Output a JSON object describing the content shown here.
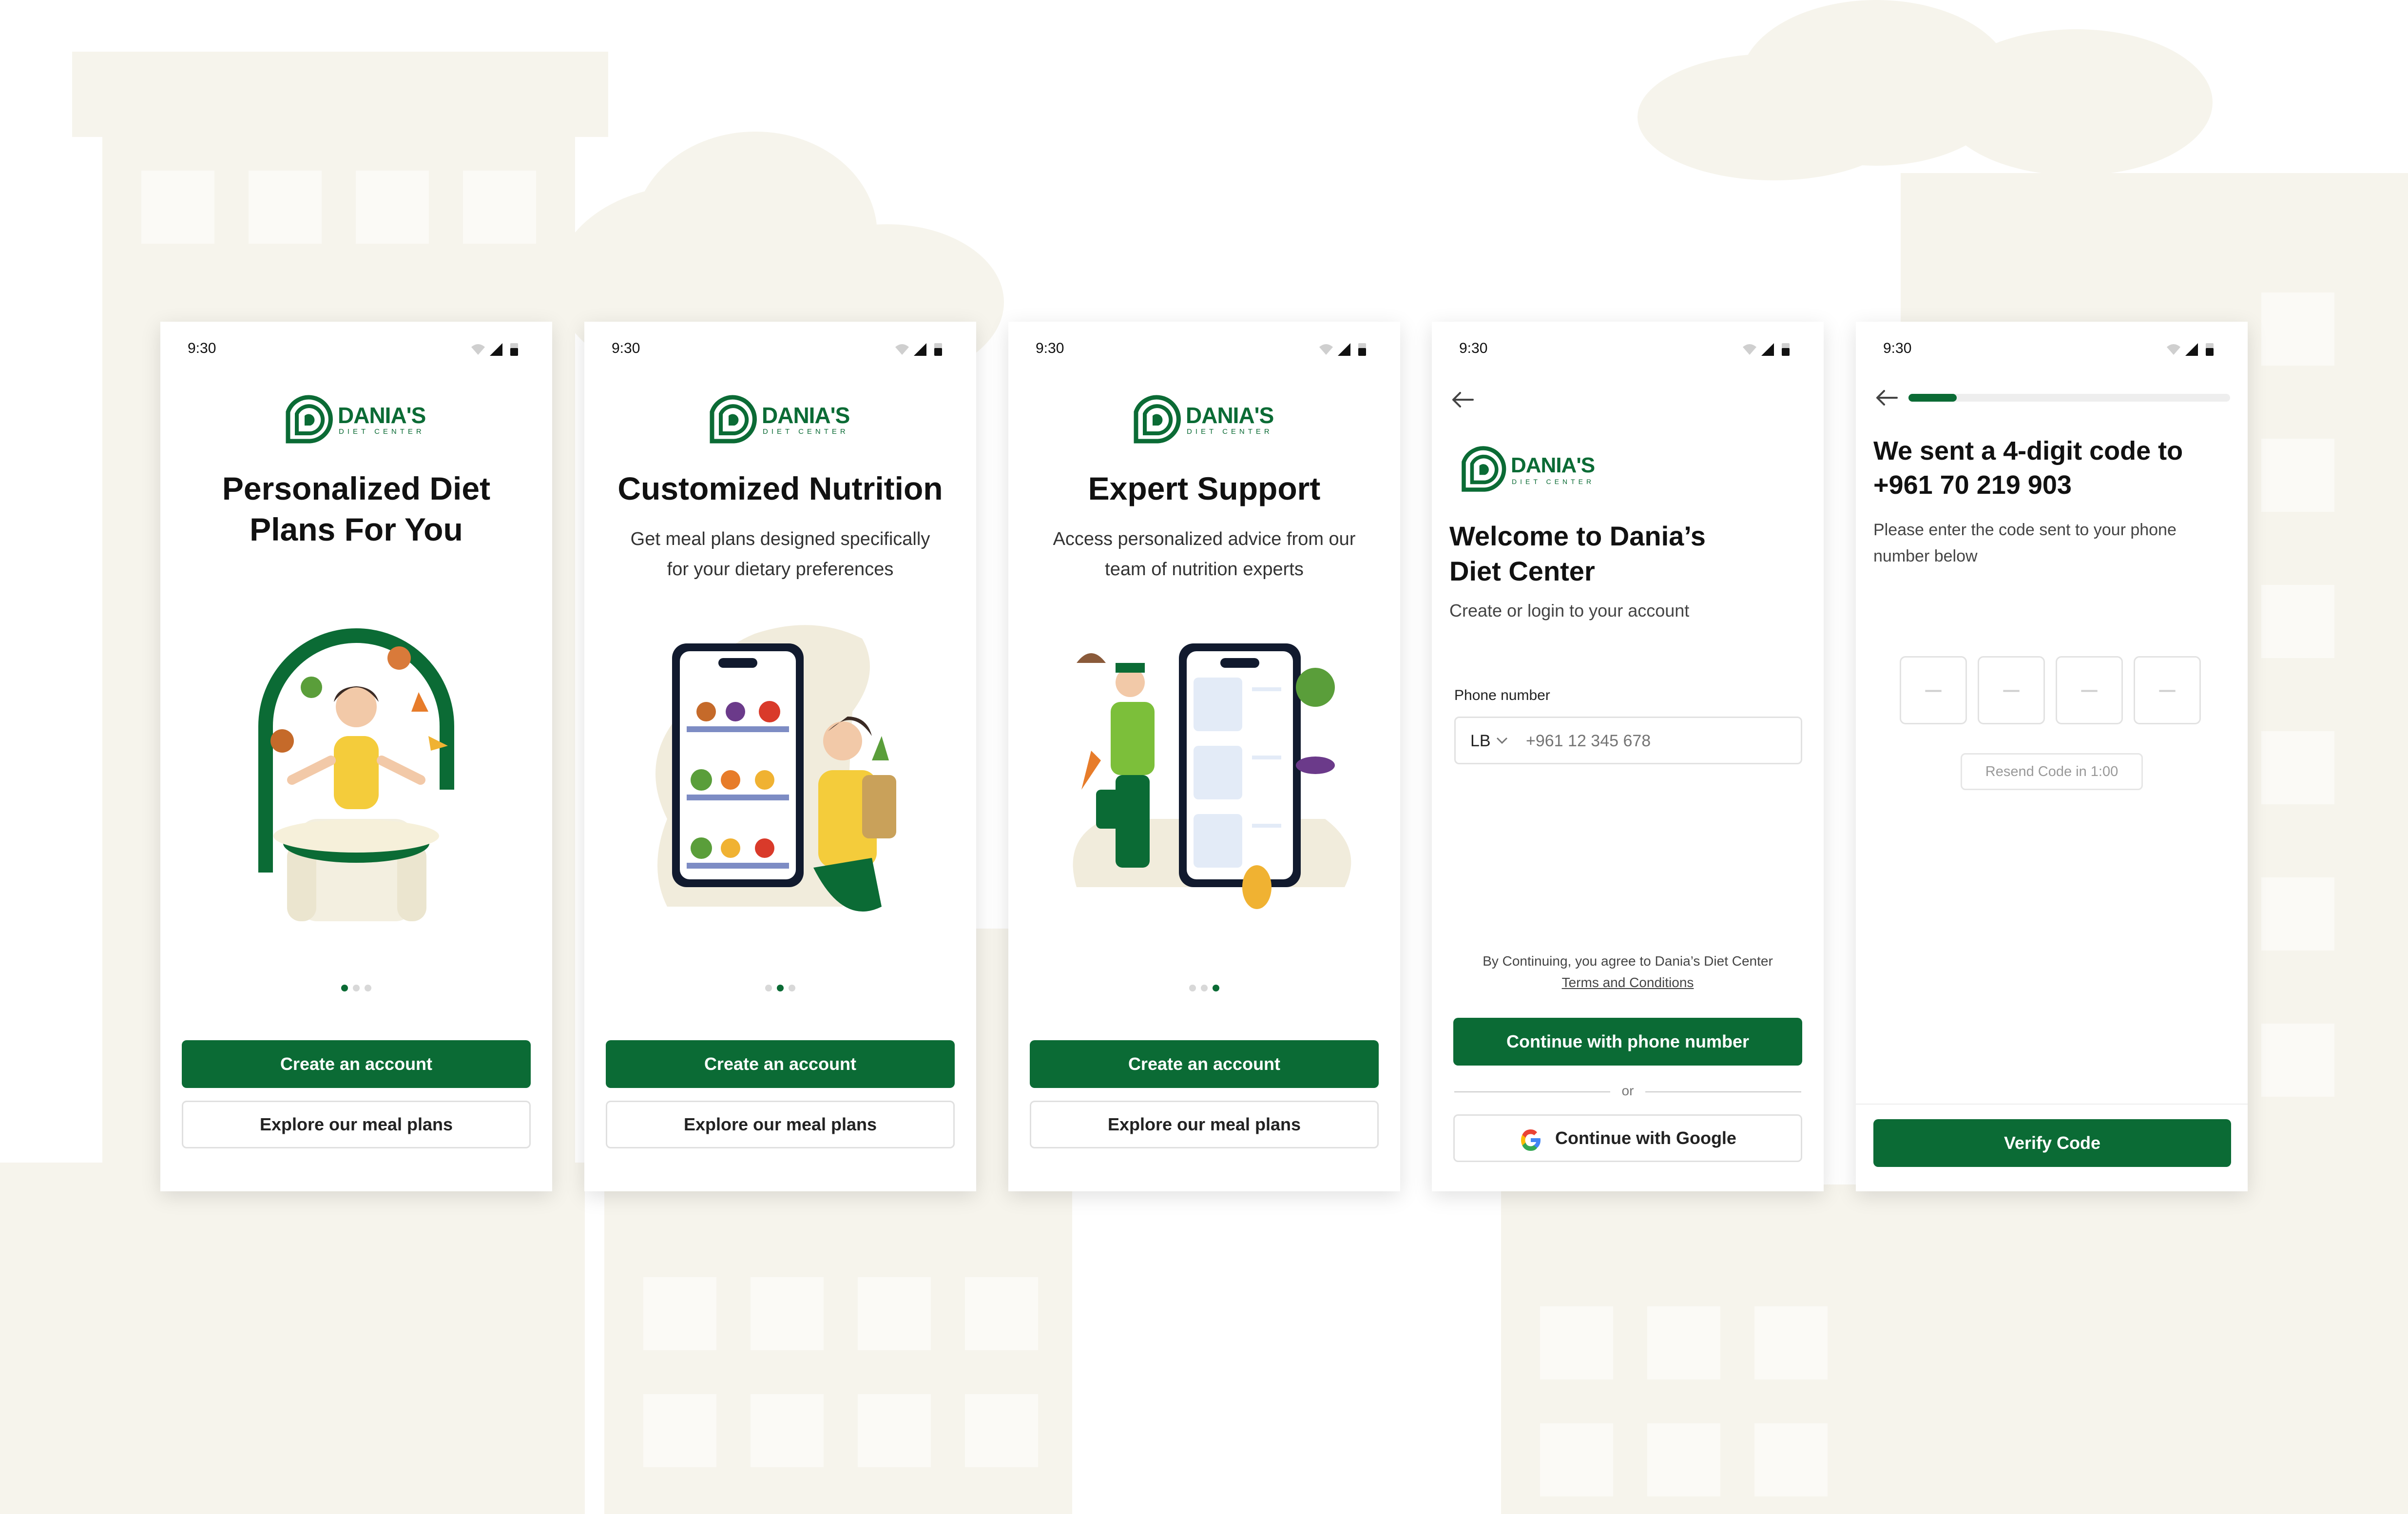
{
  "colors": {
    "brand": "#0b6b35",
    "background_shape": "#f6f4ec"
  },
  "status_bar": {
    "time": "9:30"
  },
  "logo": {
    "brand": "DANIA'S",
    "subtitle": "DIET CENTER"
  },
  "onboarding": [
    {
      "title": "Personalized Diet Plans For You",
      "subtitle": "",
      "active_dot": 1,
      "illustration": "meditating-woman-illustration"
    },
    {
      "title": "Customized Nutrition",
      "subtitle": "Get meal plans designed specifically for your dietary preferences",
      "active_dot": 2,
      "illustration": "fridge-phone-illustration"
    },
    {
      "title": "Expert Support",
      "subtitle": "Access personalized advice from our team of nutrition experts",
      "active_dot": 3,
      "illustration": "delivery-phone-illustration"
    }
  ],
  "onboarding_buttons": {
    "primary": "Create an account",
    "secondary": "Explore our meal plans"
  },
  "login": {
    "heading": "Welcome to Dania’s Diet Center",
    "subtitle": "Create or login to your account",
    "phone_label": "Phone number",
    "country_code": "LB",
    "phone_placeholder": "+961 12 345 678",
    "terms_prefix": "By Continuing, you agree to Dania’s Diet Center",
    "terms_link": "Terms and Conditions",
    "continue_phone": "Continue with phone number",
    "or": "or",
    "continue_google": "Continue with Google"
  },
  "verify": {
    "heading": "We sent a 4-digit code to +961 70 219 903",
    "subtitle": "Please enter the code sent to your phone number below",
    "code_placeholder": "–",
    "resend": "Resend Code in 1:00",
    "verify_button": "Verify Code",
    "progress": 0.15
  }
}
